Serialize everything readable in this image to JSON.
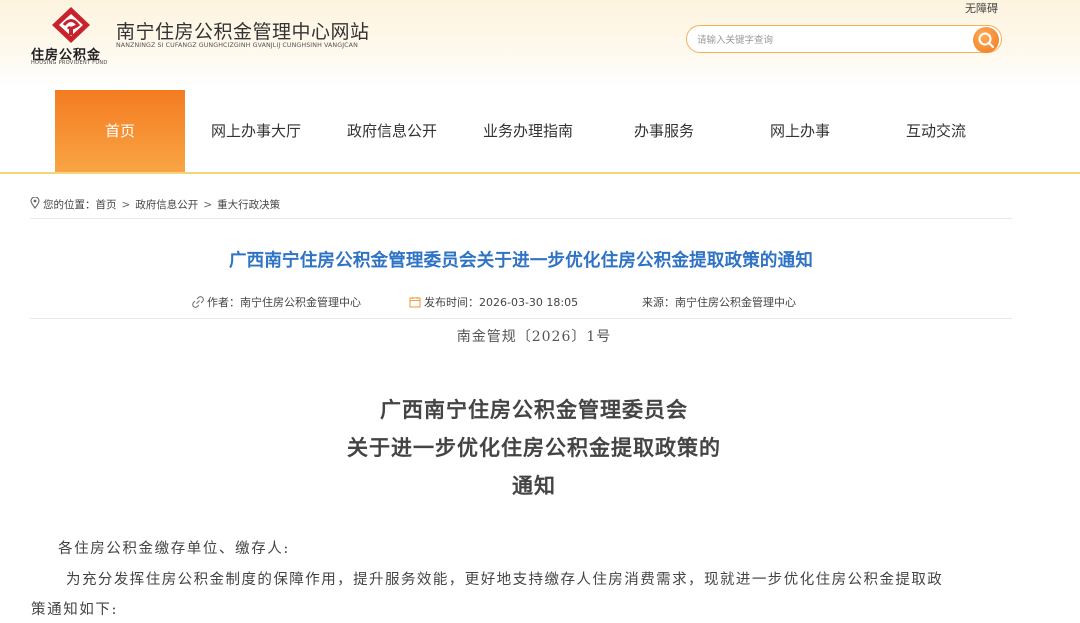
{
  "header": {
    "logo_text": "住房公积金",
    "logo_en": "HOUSING PROVIDENT FUND",
    "site_title": "南宁住房公积金管理中心网站",
    "site_title_en": "NANZNINGZ SI CUFANGZ GUNGHCIZGINH GVANJLIJ CUNGHSINH VANGJCAN",
    "accessibility": "无障碍",
    "search_placeholder": "请输入关键字查询",
    "brand_color": "#c8232c",
    "accent_color": "#f47b20"
  },
  "nav": {
    "items": [
      {
        "label": "首页",
        "active": true
      },
      {
        "label": "网上办事大厅",
        "active": false
      },
      {
        "label": "政府信息公开",
        "active": false
      },
      {
        "label": "业务办理指南",
        "active": false
      },
      {
        "label": "办事服务",
        "active": false
      },
      {
        "label": "网上办事",
        "active": false
      },
      {
        "label": "互动交流",
        "active": false
      }
    ]
  },
  "breadcrumb": {
    "prefix": "您的位置：",
    "items": [
      "首页",
      "政府信息公开",
      "重大行政决策"
    ],
    "separator": ">"
  },
  "article": {
    "title": "广西南宁住房公积金管理委员会关于进一步优化住房公积金提取政策的通知",
    "author": "作者：南宁住房公积金管理中心",
    "published": "发布时间：2026-03-30 18:05",
    "source": "来源：南宁住房公积金管理中心",
    "title_color": "#2f73c4"
  },
  "document": {
    "number": "南金管规〔2026〕1号",
    "title_lines": [
      "广西南宁住房公积金管理委员会",
      "关于进一步优化住房公积金提取政策的",
      "通知"
    ],
    "salutation": "各住房公积金缴存单位、缴存人:",
    "paragraph_line1": "为充分发挥住房公积金制度的保障作用，提升服务效能，更好地支持缴存人住房消费需求，现就进一步优化住房公积金提取政",
    "paragraph_line2": "策通知如下:"
  }
}
